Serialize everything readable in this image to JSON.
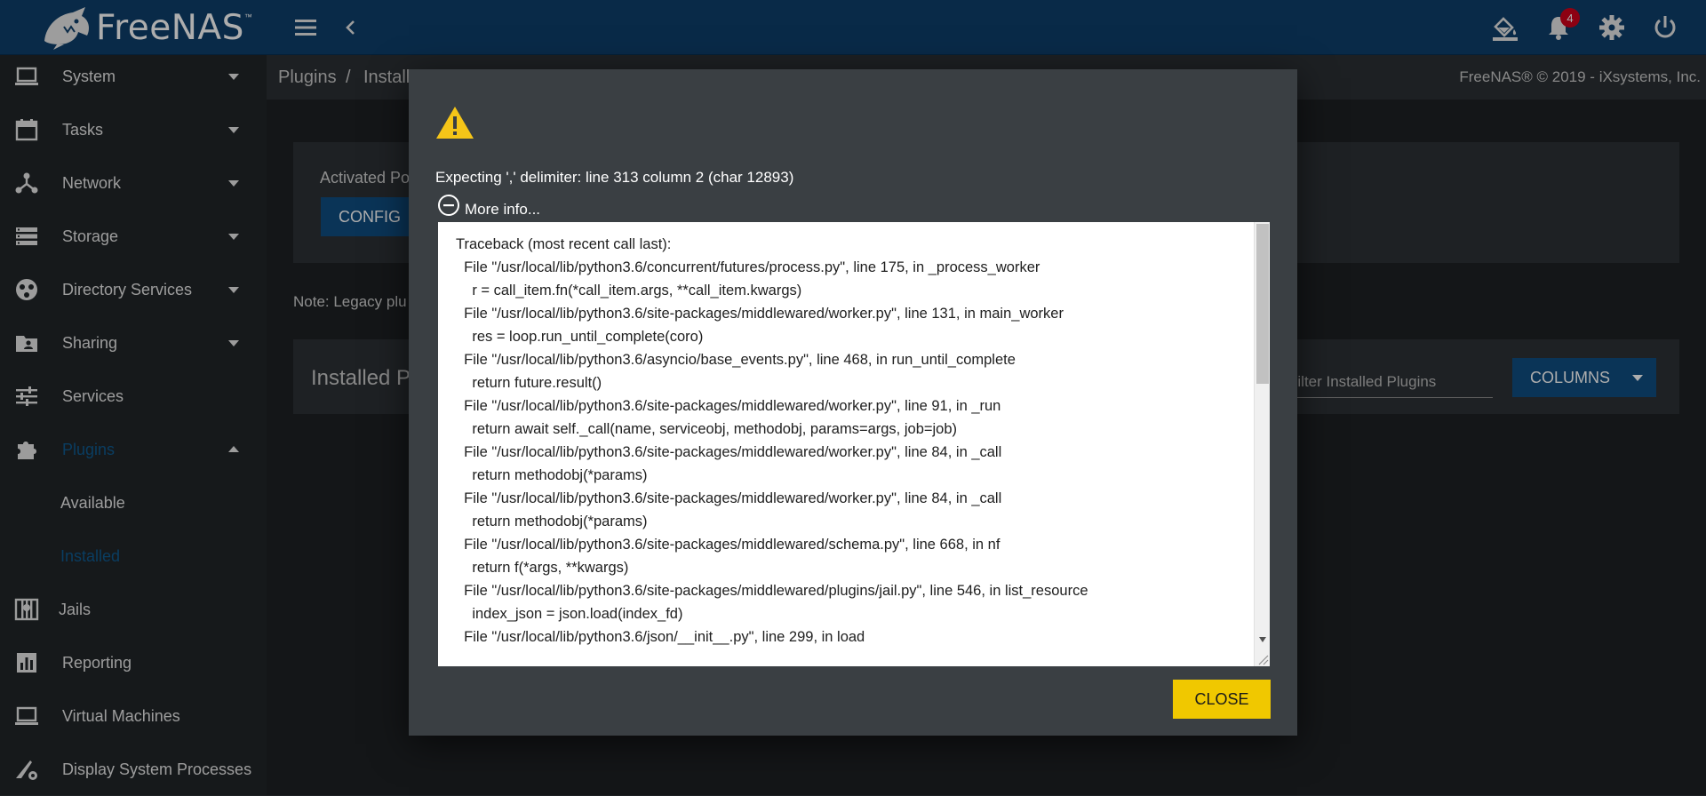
{
  "app": {
    "logo_text": "FreeNAS",
    "logo_tm": "™",
    "notification_count": "4"
  },
  "topbar": {
    "icons": [
      "hamburger-icon",
      "chevron-left-icon",
      "paint-bucket-icon",
      "bell-icon",
      "gear-icon",
      "power-icon"
    ]
  },
  "sidebar": {
    "items": [
      {
        "label": "System",
        "icon": "laptop-icon",
        "caret": "down"
      },
      {
        "label": "Tasks",
        "icon": "calendar-icon",
        "caret": "down"
      },
      {
        "label": "Network",
        "icon": "network-hub-icon",
        "caret": "down"
      },
      {
        "label": "Storage",
        "icon": "storage-icon",
        "caret": "down"
      },
      {
        "label": "Directory Services",
        "icon": "directory-icon",
        "caret": "down"
      },
      {
        "label": "Sharing",
        "icon": "folder-user-icon",
        "caret": "down"
      },
      {
        "label": "Services",
        "icon": "sliders-icon",
        "caret": ""
      },
      {
        "label": "Plugins",
        "icon": "puzzle-icon",
        "caret": "up"
      },
      {
        "label": "Jails",
        "icon": "jail-icon",
        "caret": ""
      },
      {
        "label": "Reporting",
        "icon": "chart-icon",
        "caret": ""
      },
      {
        "label": "Virtual Machines",
        "icon": "laptop-icon",
        "caret": ""
      },
      {
        "label": "Display System Processes",
        "icon": "process-icon",
        "caret": ""
      }
    ],
    "sub_items": [
      {
        "label": "Available"
      },
      {
        "label": "Installed"
      }
    ]
  },
  "breadcrumb": {
    "root": "Plugins",
    "separator": "/",
    "current": "Install"
  },
  "copyright": "FreeNAS® © 2019 - iXsystems, Inc.",
  "card1": {
    "title": "Activated Po",
    "config_label": "CONFIG"
  },
  "note": "Note: Legacy plu",
  "card2": {
    "title": "Installed P",
    "filter_placeholder": "Filter Installed Plugins",
    "columns_label": "COLUMNS"
  },
  "dialog": {
    "error_message": "Expecting ',' delimiter: line 313 column 2 (char 12893)",
    "more_info_label": "More info...",
    "close_label": "CLOSE",
    "traceback": "\"\"\"\nTraceback (most recent call last):\n  File \"/usr/local/lib/python3.6/concurrent/futures/process.py\", line 175, in _process_worker\n    r = call_item.fn(*call_item.args, **call_item.kwargs)\n  File \"/usr/local/lib/python3.6/site-packages/middlewared/worker.py\", line 131, in main_worker\n    res = loop.run_until_complete(coro)\n  File \"/usr/local/lib/python3.6/asyncio/base_events.py\", line 468, in run_until_complete\n    return future.result()\n  File \"/usr/local/lib/python3.6/site-packages/middlewared/worker.py\", line 91, in _run\n    return await self._call(name, serviceobj, methodobj, params=args, job=job)\n  File \"/usr/local/lib/python3.6/site-packages/middlewared/worker.py\", line 84, in _call\n    return methodobj(*params)\n  File \"/usr/local/lib/python3.6/site-packages/middlewared/worker.py\", line 84, in _call\n    return methodobj(*params)\n  File \"/usr/local/lib/python3.6/site-packages/middlewared/schema.py\", line 668, in nf\n    return f(*args, **kwargs)\n  File \"/usr/local/lib/python3.6/site-packages/middlewared/plugins/jail.py\", line 546, in list_resource\n    index_json = json.load(index_fd)\n  File \"/usr/local/lib/python3.6/json/__init__.py\", line 299, in load"
  },
  "colors": {
    "topbar": "#0e3f6a",
    "sidebar": "#212529",
    "accent_active": "#0f5a8f",
    "primary_button": "#0f4d80",
    "close_button": "#f0c800",
    "badge": "#d0021b",
    "warning": "#f5c518"
  }
}
